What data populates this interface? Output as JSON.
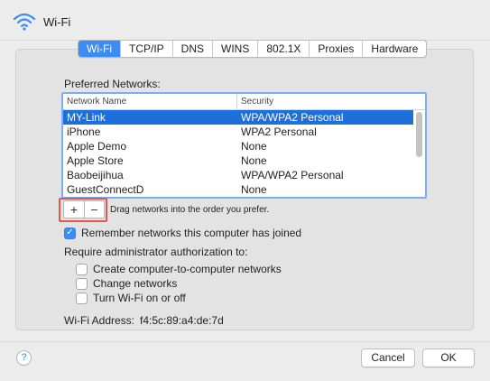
{
  "window": {
    "title": "Wi-Fi"
  },
  "tabs": [
    {
      "label": "Wi-Fi",
      "active": true
    },
    {
      "label": "TCP/IP",
      "active": false
    },
    {
      "label": "DNS",
      "active": false
    },
    {
      "label": "WINS",
      "active": false
    },
    {
      "label": "802.1X",
      "active": false
    },
    {
      "label": "Proxies",
      "active": false
    },
    {
      "label": "Hardware",
      "active": false
    }
  ],
  "preferred": {
    "label": "Preferred Networks:",
    "columns": [
      "Network Name",
      "Security"
    ],
    "rows": [
      {
        "name": "MY-Link",
        "security": "WPA/WPA2 Personal",
        "selected": true
      },
      {
        "name": "iPhone",
        "security": "WPA2 Personal",
        "selected": false
      },
      {
        "name": "Apple Demo",
        "security": "None",
        "selected": false
      },
      {
        "name": "Apple Store",
        "security": "None",
        "selected": false
      },
      {
        "name": "Baobeijihua",
        "security": "WPA/WPA2 Personal",
        "selected": false
      },
      {
        "name": "GuestConnectD",
        "security": "None",
        "selected": false
      }
    ],
    "add_label": "+",
    "remove_label": "−",
    "drag_hint": "Drag networks into the order you prefer."
  },
  "remember": {
    "label": "Remember networks this computer has joined",
    "checked": true
  },
  "admin": {
    "heading": "Require administrator authorization to:",
    "options": [
      {
        "label": "Create computer-to-computer networks",
        "checked": false
      },
      {
        "label": "Change networks",
        "checked": false
      },
      {
        "label": "Turn Wi-Fi on or off",
        "checked": false
      }
    ]
  },
  "address": {
    "label": "Wi-Fi Address:",
    "value": "f4:5c:89:a4:de:7d"
  },
  "footer": {
    "help": "?",
    "cancel": "Cancel",
    "ok": "OK"
  },
  "colors": {
    "accent": "#3b8cf5",
    "selection": "#1e6fd9",
    "highlight": "#e8544a"
  }
}
